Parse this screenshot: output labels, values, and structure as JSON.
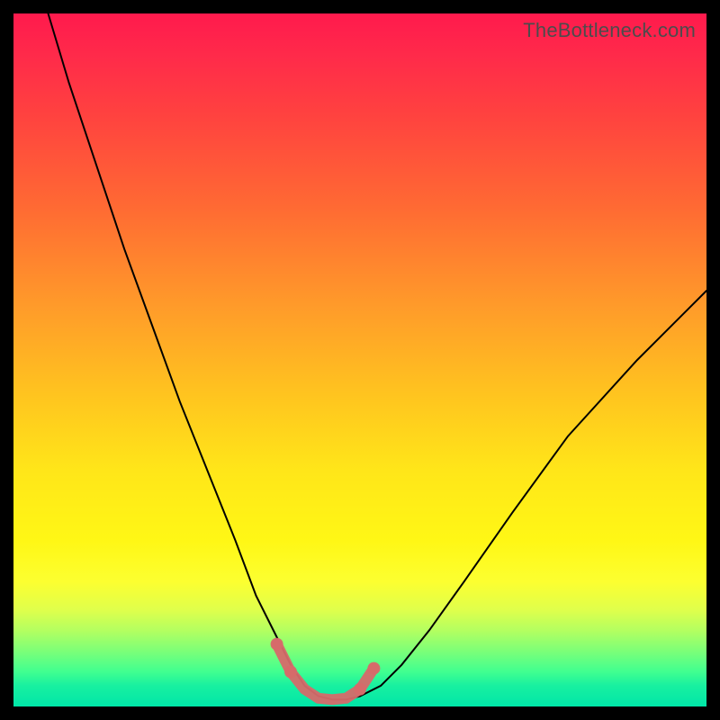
{
  "watermark": "TheBottleneck.com",
  "chart_data": {
    "type": "line",
    "title": "",
    "xlabel": "",
    "ylabel": "",
    "xlim": [
      0,
      100
    ],
    "ylim": [
      0,
      100
    ],
    "grid": false,
    "background_gradient": {
      "top": "#ff1a4d",
      "mid": "#ffe619",
      "bottom": "#00e6a8"
    },
    "series": [
      {
        "name": "bottleneck-curve",
        "color": "#000000",
        "x": [
          5,
          8,
          12,
          16,
          20,
          24,
          28,
          32,
          35,
          38,
          40,
          42,
          44,
          46,
          48,
          50,
          53,
          56,
          60,
          65,
          72,
          80,
          90,
          100
        ],
        "y": [
          100,
          90,
          78,
          66,
          55,
          44,
          34,
          24,
          16,
          10,
          6,
          3,
          1.5,
          1,
          1,
          1.5,
          3,
          6,
          11,
          18,
          28,
          39,
          50,
          60
        ]
      }
    ],
    "accent": {
      "name": "optimum-range",
      "color": "#d66a6a",
      "x": [
        38,
        40,
        42,
        44,
        46,
        48,
        50,
        52
      ],
      "y": [
        9,
        5,
        2.5,
        1.2,
        1,
        1.2,
        2.5,
        5.5
      ],
      "endpoint_dots": true
    }
  }
}
